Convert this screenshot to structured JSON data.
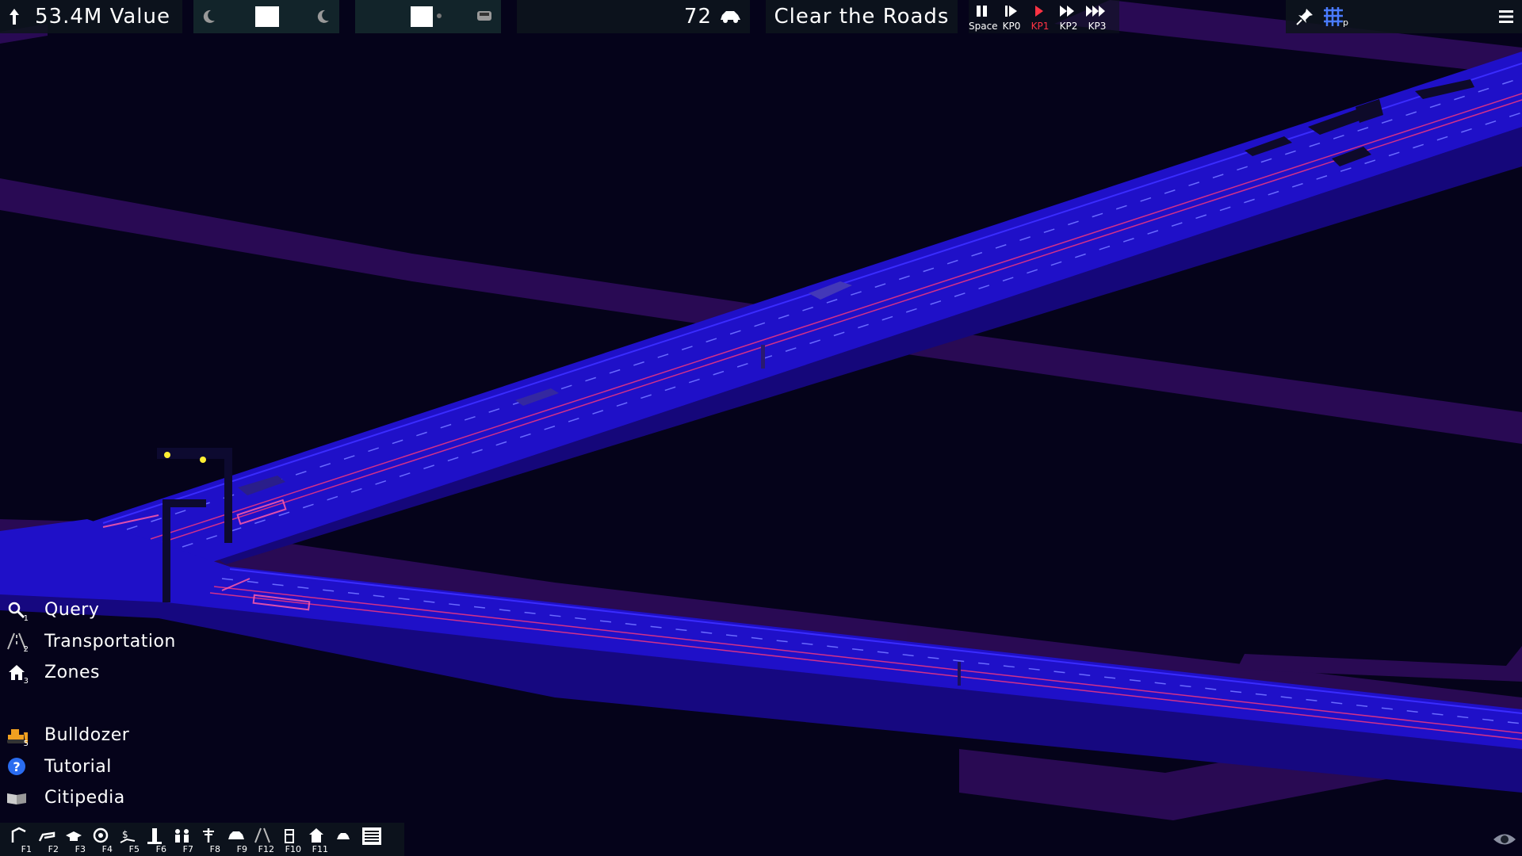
{
  "hud": {
    "value_text": "53.4M Value",
    "vehicle_count": "72",
    "objective": "Clear the Roads"
  },
  "speed": [
    {
      "label": "Space",
      "icon": "pause-icon",
      "active": false
    },
    {
      "label": "KP0",
      "icon": "step-icon",
      "active": false
    },
    {
      "label": "KP1",
      "icon": "play-icon",
      "active": true
    },
    {
      "label": "KP2",
      "icon": "fast-forward-icon",
      "active": false
    },
    {
      "label": "KP3",
      "icon": "fastest-forward-icon",
      "active": false
    }
  ],
  "grid_shortcut": "p",
  "menu": [
    {
      "label": "Query",
      "key": "1",
      "icon": "magnifier-icon"
    },
    {
      "label": "Transportation",
      "key": "2",
      "icon": "road-icon"
    },
    {
      "label": "Zones",
      "key": "3",
      "icon": "house-icon"
    },
    {
      "label": "Bulldozer",
      "key": "5",
      "icon": "bulldozer-icon"
    },
    {
      "label": "Tutorial",
      "key": "",
      "icon": "help-icon"
    },
    {
      "label": "Citipedia",
      "key": "",
      "icon": "book-icon"
    }
  ],
  "toolbar": [
    "F1",
    "F2",
    "F3",
    "F4",
    "F5",
    "F6",
    "F7",
    "F8",
    "F9",
    "F12",
    "F10",
    "F11"
  ],
  "colors": {
    "road": "#1f10c8",
    "road_edge": "#2a1cff",
    "lane_marking": "#ff3a7a",
    "terrain": "#2a0a55",
    "background": "#05031a",
    "hud_bg": "#0e141c",
    "active_red": "#ff3344",
    "traffic_light": "#ffee33"
  }
}
